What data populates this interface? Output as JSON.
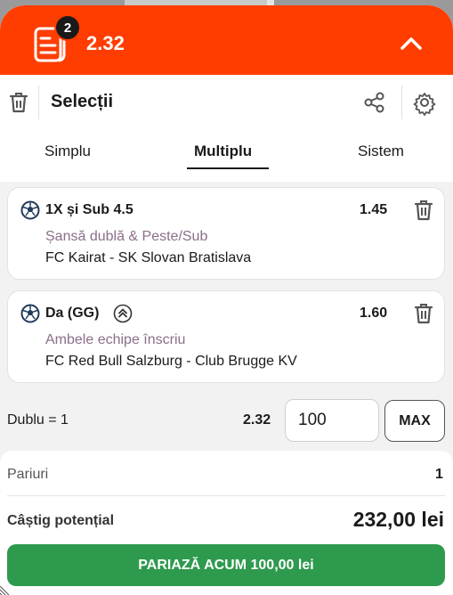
{
  "colors": {
    "header": "#ff3d00",
    "accent_button": "#2e9a4e",
    "market_text": "#8a6f8a"
  },
  "header": {
    "selection_count": "2",
    "total_odds": "2.32"
  },
  "toolbar": {
    "title": "Selecții"
  },
  "tabs": [
    {
      "label": "Simplu"
    },
    {
      "label": "Multiplu",
      "active": true
    },
    {
      "label": "Sistem"
    }
  ],
  "selections": [
    {
      "pick": "1X și Sub 4.5",
      "odds": "1.45",
      "market": "Șansă dublă & Peste/Sub",
      "match": "FC Kairat - SK Slovan Bratislava",
      "icon": "soccer-ball-icon"
    },
    {
      "pick": "Da (GG)",
      "odds": "1.60",
      "market": "Ambele echipe înscriu",
      "match": "FC Red Bull Salzburg - Club Brugge KV",
      "icon": "soccer-ball-icon",
      "badge_icon": "boost-icon"
    }
  ],
  "stake_row": {
    "label": "Dublu = 1",
    "odds": "2.32",
    "stake_value": "100",
    "max_label": "MAX"
  },
  "summary": {
    "bets_label": "Pariuri",
    "bets_value": "1",
    "potential_label": "Câștig potențial",
    "potential_value": "232,00 lei"
  },
  "place_bet": {
    "label": "PARIAZĂ ACUM 100,00 lei"
  }
}
